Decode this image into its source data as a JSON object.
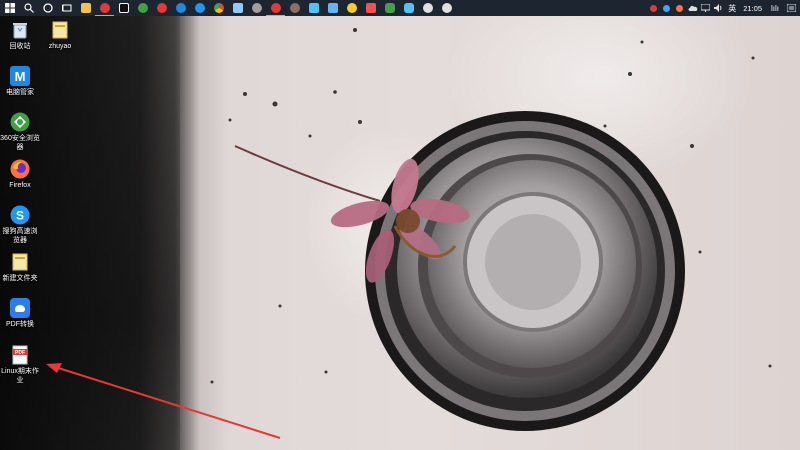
{
  "taskbar": {
    "pinned": [
      {
        "icon": "windows-start-icon",
        "color": "#ffffff"
      },
      {
        "icon": "search-icon",
        "color": "#ffffff"
      },
      {
        "icon": "cortana-icon",
        "color": "#ffffff"
      },
      {
        "icon": "task-view-icon",
        "color": "#ffffff"
      },
      {
        "icon": "file-explorer-icon",
        "color": "#f2c14e"
      },
      {
        "icon": "red-app-icon",
        "color": "#e53935"
      },
      {
        "icon": "capcut-icon",
        "color": "#ffffff"
      },
      {
        "icon": "360-browser-icon",
        "color": "#3fa142"
      },
      {
        "icon": "red-circle-app-icon",
        "color": "#e53935"
      },
      {
        "icon": "edge-browser-icon",
        "color": "#1e88e5"
      },
      {
        "icon": "sogou-browser-icon",
        "color": "#2196f3"
      },
      {
        "icon": "chrome-icon",
        "color": "#fbbc05"
      },
      {
        "icon": "photos-icon",
        "color": "#90caf9"
      },
      {
        "icon": "steam-icon",
        "color": "#9e9e9e"
      },
      {
        "icon": "netease-music-icon",
        "color": "#e53935"
      },
      {
        "icon": "user-avatar-icon",
        "color": "#8d6e63"
      },
      {
        "icon": "screen-app-icon",
        "color": "#4fc3f7"
      },
      {
        "icon": "image-viewer-icon",
        "color": "#64b5f6"
      },
      {
        "icon": "emoji-app-icon",
        "color": "#ffca28"
      },
      {
        "icon": "pdf-app-icon",
        "color": "#ef5350"
      },
      {
        "icon": "wechat-icon",
        "color": "#43a047"
      },
      {
        "icon": "dingtalk-icon",
        "color": "#4fc3f7"
      },
      {
        "icon": "360-security-icon",
        "color": "#e0e0e0"
      },
      {
        "icon": "qq-icon",
        "color": "#e0e0e0"
      }
    ],
    "tray": [
      {
        "icon": "red-tray-icon",
        "color": "#e53935"
      },
      {
        "icon": "blue-tray-icon",
        "color": "#42a5f5"
      },
      {
        "icon": "orange-tray-icon",
        "color": "#ff7043"
      },
      {
        "icon": "onedrive-icon",
        "color": "#e0e0e0"
      },
      {
        "icon": "network-icon",
        "color": "#e0e0e0"
      },
      {
        "icon": "volume-icon",
        "color": "#e0e0e0"
      }
    ],
    "ime": "英",
    "clock": "21:05",
    "wifi_label": "lılı",
    "notification_icon": "action-center-icon"
  },
  "desktop": {
    "icons": [
      {
        "label": "回收站",
        "icon": "recycle-bin-icon",
        "color": "#dfe6ee"
      },
      {
        "label": "zhuyao",
        "icon": "folder-icon",
        "color": "#f5d36b"
      },
      {
        "label": "电脑管家",
        "icon": "pc-manager-icon",
        "color": "#1e88e5"
      },
      {
        "label": "360安全浏览器",
        "icon": "360-browser-icon",
        "color": "#3fa142"
      },
      {
        "label": "Firefox",
        "icon": "firefox-icon",
        "color": "#ff7139"
      },
      {
        "label": "搜狗高速浏览器",
        "icon": "sogou-browser-icon",
        "color": "#2196f3"
      },
      {
        "label": "新建文件夹",
        "icon": "folder-icon",
        "color": "#f5d36b"
      },
      {
        "label": "PDF转换",
        "icon": "pdf-convert-icon",
        "color": "#2b7de9"
      },
      {
        "label": "Linux期末作业",
        "icon": "pdf-file-icon",
        "color": "#e53935"
      }
    ]
  },
  "wallpaper": {
    "desc_colors": {
      "sink": "#b9b3b2",
      "flower": "#b86c84",
      "shadow": "#111111"
    }
  },
  "annotation": {
    "arrow_color": "#e53935"
  }
}
